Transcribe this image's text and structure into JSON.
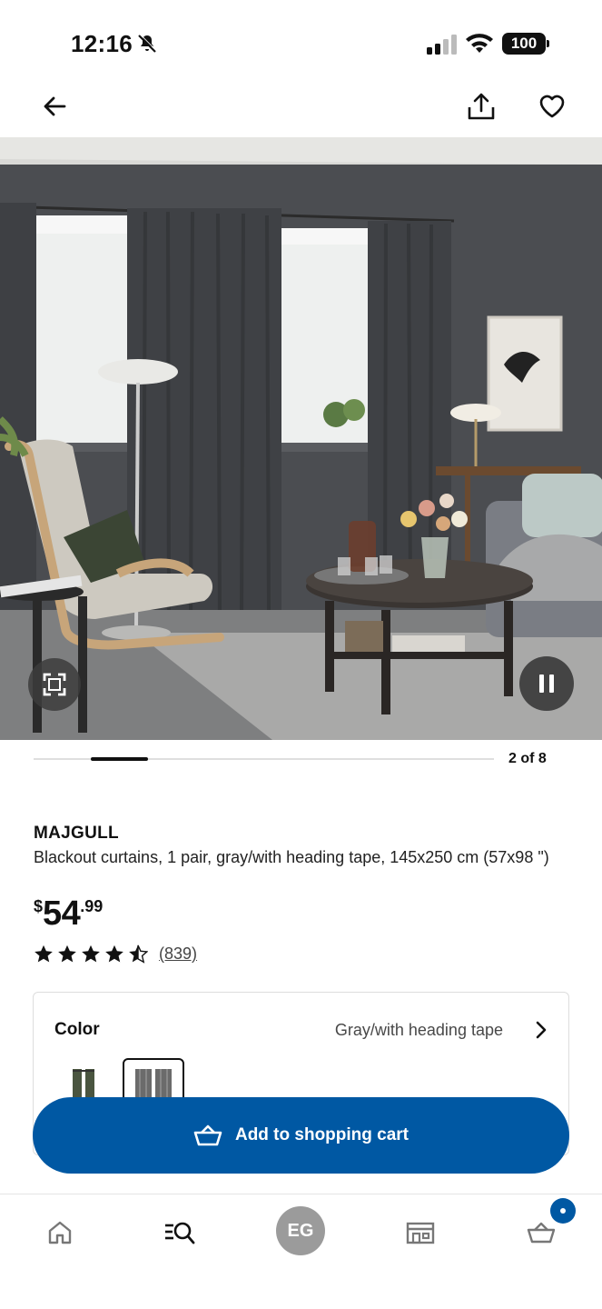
{
  "status_bar": {
    "time": "12:16",
    "battery": "100"
  },
  "header": {
    "back_icon": "arrow-left-icon",
    "share_icon": "share-icon",
    "favorite_icon": "heart-icon"
  },
  "carousel": {
    "counter": "2 of 8",
    "current": 2,
    "total": 8
  },
  "product": {
    "brand": "MAJGULL",
    "description": "Blackout curtains, 1 pair, gray/with heading tape, 145x250 cm (57x98 \")",
    "price": {
      "currency": "$",
      "integer": "54",
      "decimal": ".99"
    },
    "rating": {
      "stars": 4.5,
      "max": 5,
      "count": "(839)"
    }
  },
  "color_selector": {
    "label": "Color",
    "selected_value": "Gray/with heading tape",
    "swatches": [
      {
        "name": "dark-green",
        "color": "#4a5540"
      },
      {
        "name": "gray",
        "color": "#6b6b6b",
        "selected": true
      }
    ]
  },
  "cart_button": {
    "label": "Add to shopping cart",
    "color": "#0058a3"
  },
  "bottom_nav": {
    "items": [
      {
        "name": "home",
        "icon": "home-icon"
      },
      {
        "name": "search",
        "icon": "search-icon",
        "active": true
      },
      {
        "name": "profile",
        "initials": "EG"
      },
      {
        "name": "stores",
        "icon": "store-icon"
      },
      {
        "name": "cart",
        "icon": "cart-icon"
      }
    ]
  },
  "colors": {
    "accent": "#0058a3",
    "text": "#111111",
    "muted": "#484848"
  }
}
